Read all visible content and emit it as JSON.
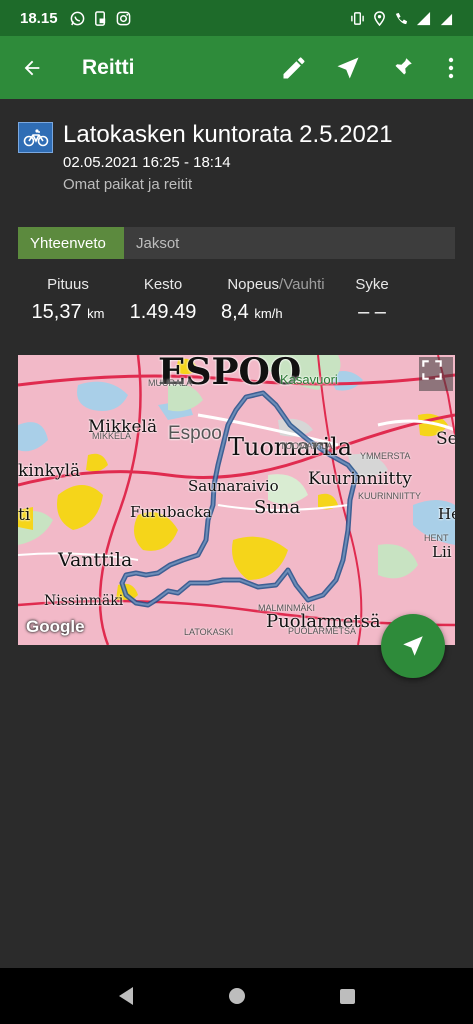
{
  "status_bar": {
    "time": "18.15",
    "icons": [
      "whatsapp-icon",
      "phone-lock-icon",
      "instagram-icon"
    ],
    "right_icons": [
      "vibrate-icon",
      "location-icon",
      "call-4g-icon",
      "4g-signal-icon",
      "battery-icon"
    ]
  },
  "app_bar": {
    "title": "Reitti",
    "actions": [
      "edit-icon",
      "navigate-icon",
      "pin-icon",
      "more-icon"
    ]
  },
  "route": {
    "name": "Latokasken kuntorata 2.5.2021",
    "time_range": "02.05.2021 16:25 - 18:14",
    "folder": "Omat paikat ja reitit",
    "type_icon": "bicycle-icon"
  },
  "tabs": [
    {
      "label": "Yhteenveto",
      "active": true
    },
    {
      "label": "Jaksot",
      "active": false
    }
  ],
  "stats": {
    "distance": {
      "label": "Pituus",
      "value": "15,37",
      "unit": "km"
    },
    "duration": {
      "label": "Kesto",
      "value": "1.49.49"
    },
    "speed": {
      "label": "Nopeus",
      "label_sub": "/Vauhti",
      "value": "8,4",
      "unit": "km/h"
    },
    "heart_rate": {
      "label": "Syke",
      "value": "– –"
    }
  },
  "map": {
    "labels": {
      "espoo_big": "ESPOO",
      "kasavuori": "Kasavuori",
      "muurala": "MUURALA",
      "mikkela": "Mikkelä",
      "mikkela_small": "MIKKELÄ",
      "espoo": "Espoo",
      "tuomarila": "Tuomarila",
      "tuomarila_small": "TUOMARILA",
      "ymmersta": "YMMERSTA",
      "kuurinniitty": "Kuurinniitty",
      "kuurinniitty_small": "KUURINNIITTY",
      "kilo": "kinkylä",
      "saunaraivio": "Saunaraivio",
      "furubacka": "Furubacka",
      "suna": "Suna",
      "vanttila": "Vanttila",
      "nissinmaki": "Nissinmäki",
      "malminmaki": "MALMINMÄKI",
      "latokaski": "LATOKASKI",
      "puolarmetsa": "Puolarmetsä",
      "puolarmetsa_small": "PUOLARMETSÄ",
      "henttaa": "HENT",
      "se": "Se",
      "li": "Lii",
      "he": "He",
      "ti": "ti"
    },
    "attribution": "Google",
    "route_color": "#3a5f8f"
  },
  "fab_icon": "navigate-icon",
  "nav_bar": [
    "back-icon",
    "home-icon",
    "recents-icon"
  ],
  "colors": {
    "status_bar": "#1e6b2a",
    "app_bar": "#2e8b3a",
    "background": "#2b2b2b",
    "tab_active": "#5c8a3e"
  }
}
